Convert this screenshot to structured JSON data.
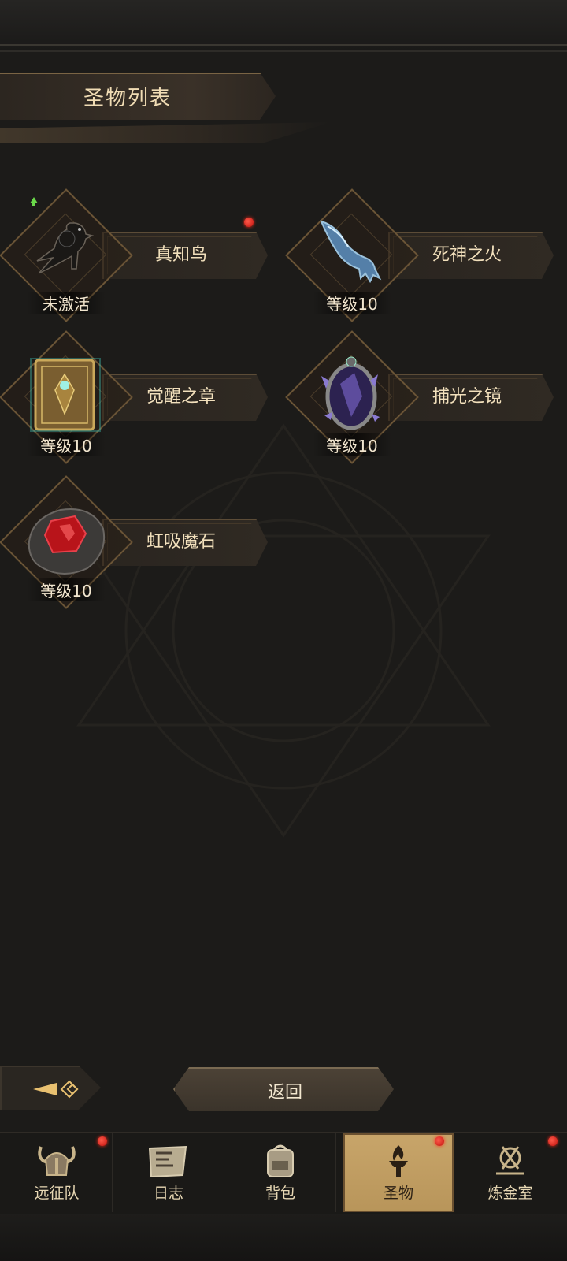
{
  "page": {
    "title": "圣物列表"
  },
  "relics": [
    {
      "name": "真知鸟",
      "status": "未激活",
      "icon": "raven-icon",
      "has_red_dot": true,
      "has_up_arrow": true
    },
    {
      "name": "死神之火",
      "status": "等级10",
      "icon": "ghost-hand-icon",
      "has_red_dot": false,
      "has_up_arrow": false
    },
    {
      "name": "觉醒之章",
      "status": "等级10",
      "icon": "tome-icon",
      "has_red_dot": false,
      "has_up_arrow": false
    },
    {
      "name": "捕光之镜",
      "status": "等级10",
      "icon": "mirror-icon",
      "has_red_dot": false,
      "has_up_arrow": false
    },
    {
      "name": "虹吸魔石",
      "status": "等级10",
      "icon": "red-stone-icon",
      "has_red_dot": false,
      "has_up_arrow": false
    }
  ],
  "actions": {
    "back_label": "返回"
  },
  "nav": {
    "tabs": [
      {
        "label": "远征队",
        "icon": "viking-helmet-icon",
        "active": false,
        "red_dot": true
      },
      {
        "label": "日志",
        "icon": "scroll-map-icon",
        "active": false,
        "red_dot": false
      },
      {
        "label": "背包",
        "icon": "backpack-icon",
        "active": false,
        "red_dot": false
      },
      {
        "label": "圣物",
        "icon": "torch-icon",
        "active": true,
        "red_dot": true
      },
      {
        "label": "炼金室",
        "icon": "alchemy-icon",
        "active": false,
        "red_dot": true
      }
    ]
  },
  "colors": {
    "accent_gold": "#c8a56a",
    "frame_brown": "#6a5436",
    "background": "#1c1b19",
    "red_dot": "#e0201a"
  }
}
